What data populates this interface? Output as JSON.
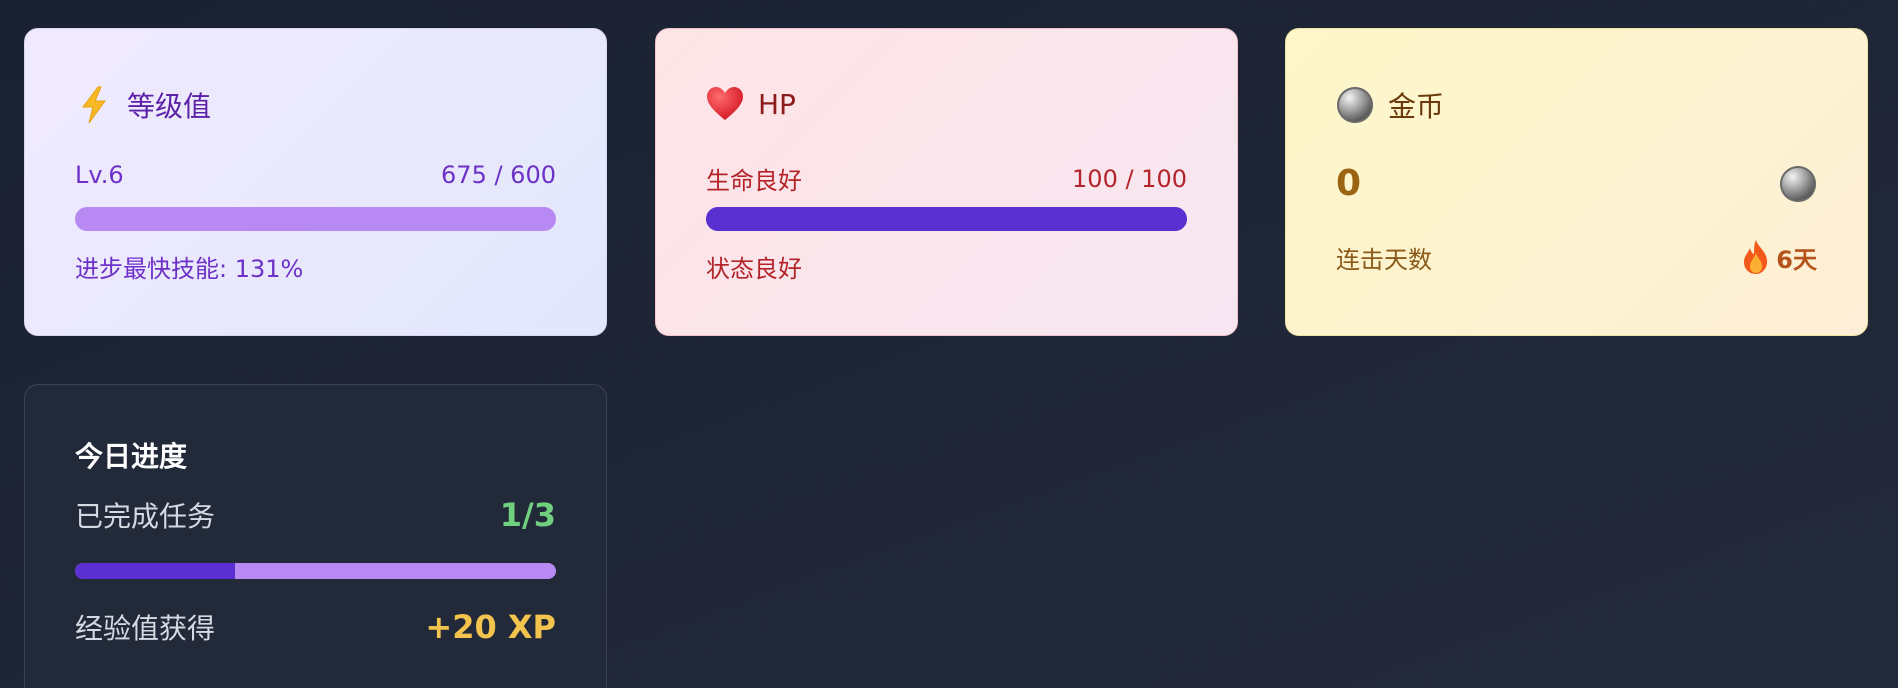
{
  "level_card": {
    "icon": "lightning-icon",
    "title": "等级值",
    "level": "Lv.6",
    "xp": "675 / 600",
    "progress": 1.0,
    "fastest_skill": "进步最快技能: 131%"
  },
  "hp_card": {
    "icon": "heart-icon",
    "title": "HP",
    "status_label": "生命良好",
    "hp": "100 / 100",
    "progress": 1.0,
    "state": "状态良好"
  },
  "coin_card": {
    "icon": "coin-icon",
    "title": "金币",
    "amount": "0",
    "streak_label": "连击天数",
    "streak_icon": "fire-icon",
    "streak_value": "6天"
  },
  "today_card": {
    "title": "今日进度",
    "tasks_label": "已完成任务",
    "tasks_value": "1/3",
    "progress": 0.3333,
    "xp_label": "经验值获得",
    "xp_value": "+20 XP"
  },
  "colors": {
    "purple": "#5b30d0",
    "lavender": "#b889f2",
    "green": "#6fd17f",
    "gold": "#f2c44d"
  }
}
